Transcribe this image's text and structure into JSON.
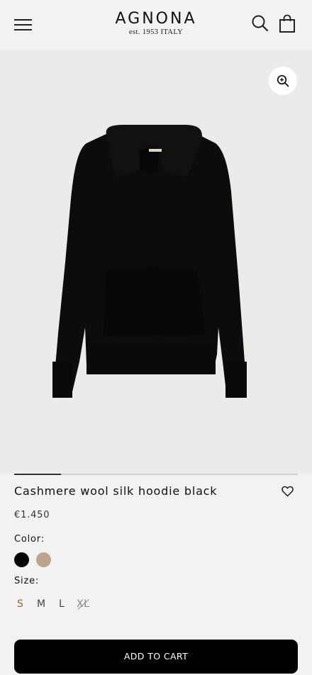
{
  "header": {
    "logo_name": "AGNONA",
    "logo_subtitle": "est. 1953 ITALY",
    "menu_icon": "hamburger-menu-icon",
    "search_icon": "search-icon",
    "bag_icon": "shopping-bag-icon"
  },
  "gallery": {
    "zoom_icon": "zoom-in-icon",
    "image_subject": "black cashmere hoodie",
    "progress": 0.165
  },
  "product": {
    "title": "Cashmere wool silk hoodie black",
    "price": "€1.450",
    "wishlist_icon": "heart-outline-icon",
    "color_label": "Color:",
    "colors": [
      {
        "name": "black",
        "hex": "#050505",
        "selected": true
      },
      {
        "name": "beige",
        "hex": "#bca58c",
        "selected": false
      }
    ],
    "size_label": "Size:",
    "sizes": [
      {
        "label": "S",
        "selected": true,
        "available": true
      },
      {
        "label": "M",
        "selected": false,
        "available": true
      },
      {
        "label": "L",
        "selected": false,
        "available": true
      },
      {
        "label": "XL",
        "selected": false,
        "available": false
      }
    ],
    "add_to_cart": "ADD TO CART"
  },
  "colors": {
    "background": "#f2f2f2",
    "selected_size": "#a0642e",
    "button": "#000000"
  }
}
